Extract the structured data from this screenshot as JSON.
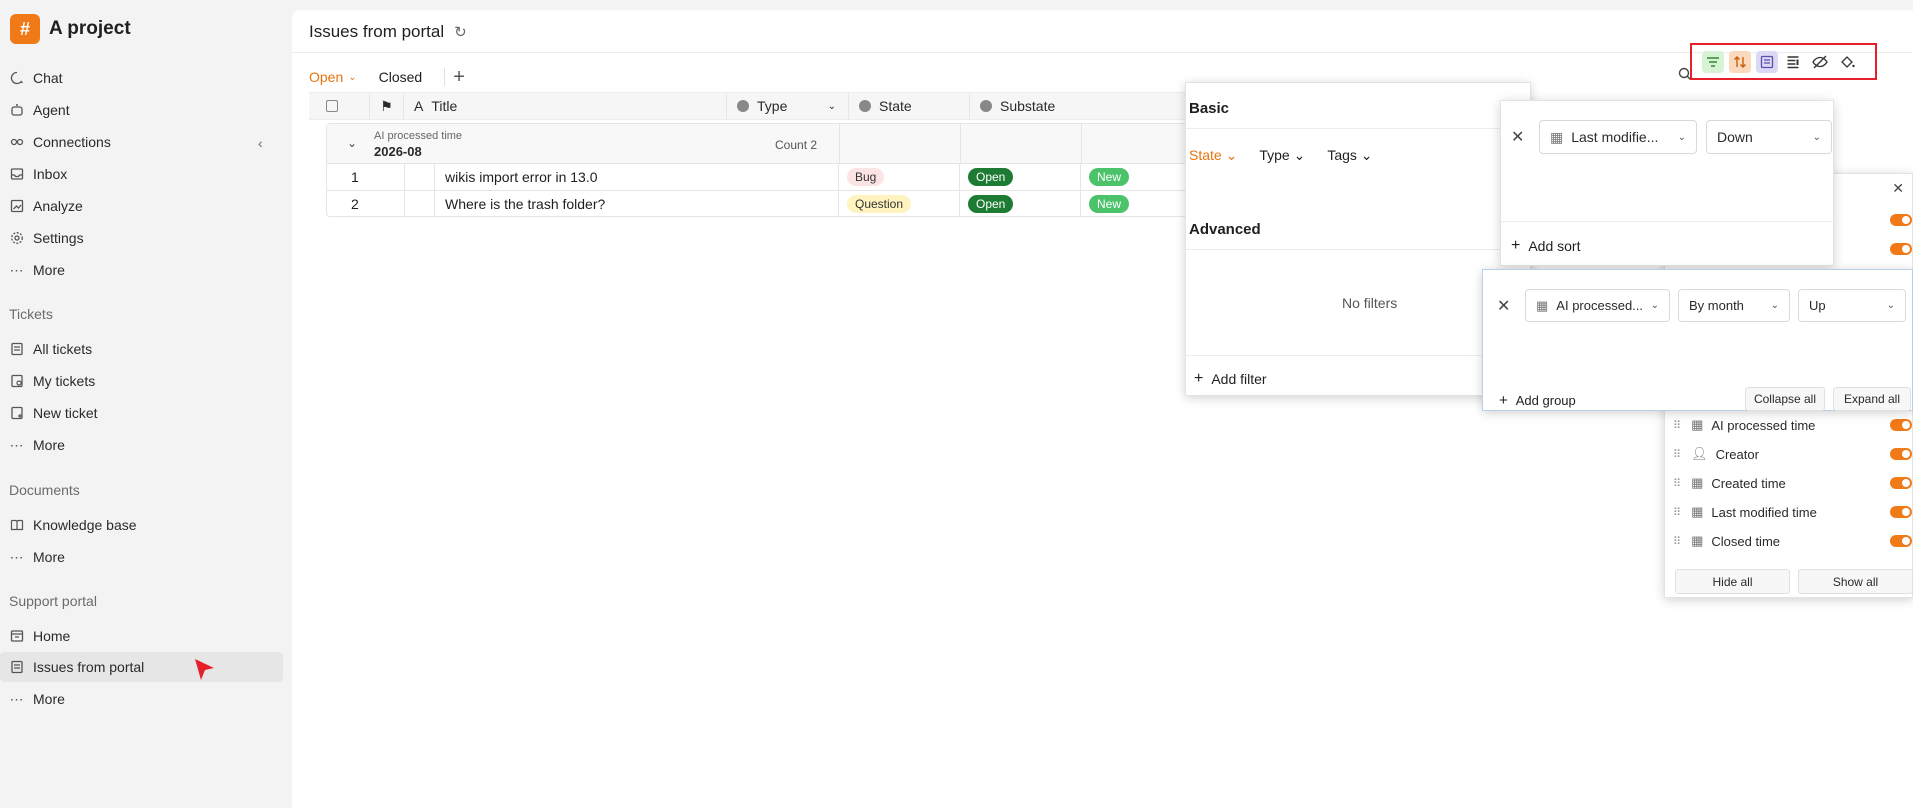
{
  "project": {
    "logo": "#",
    "name": "A project"
  },
  "nav": [
    {
      "label": "Chat",
      "icon": "chat-icon"
    },
    {
      "label": "Agent",
      "icon": "agent-icon"
    },
    {
      "label": "Connections",
      "icon": "connections-icon"
    },
    {
      "label": "Inbox",
      "icon": "inbox-icon"
    },
    {
      "label": "Analyze",
      "icon": "analyze-icon"
    },
    {
      "label": "Settings",
      "icon": "gear-icon"
    },
    {
      "label": "More",
      "icon": "more-icon"
    }
  ],
  "sections": {
    "tickets": {
      "title": "Tickets",
      "items": [
        "All tickets",
        "My tickets",
        "New ticket",
        "More"
      ]
    },
    "documents": {
      "title": "Documents",
      "items": [
        "Knowledge base",
        "More"
      ]
    },
    "portal": {
      "title": "Support portal",
      "items": [
        "Home",
        "Issues from portal",
        "More"
      ]
    }
  },
  "page": {
    "title": "Issues from portal"
  },
  "tabs": {
    "open": "Open",
    "closed": "Closed"
  },
  "columns": {
    "title": "Title",
    "type": "Type",
    "state": "State",
    "substate": "Substate"
  },
  "group": {
    "label": "AI processed time",
    "value": "2026-08",
    "count": "Count 2"
  },
  "rows": [
    {
      "num": "1",
      "title": "wikis import error in 13.0",
      "type": "Bug",
      "state": "Open",
      "substate": "New"
    },
    {
      "num": "2",
      "title": "Where is the trash folder?",
      "type": "Question",
      "state": "Open",
      "substate": "New"
    }
  ],
  "filter_panel": {
    "basic": "Basic",
    "chips": [
      "State",
      "Type",
      "Tags"
    ],
    "advanced": "Advanced",
    "empty": "No filters",
    "add": "Add filter"
  },
  "sort_panel": {
    "field": "Last modifie...",
    "direction": "Down",
    "add": "Add sort"
  },
  "group_panel": {
    "field": "AI processed...",
    "granularity": "By month",
    "direction": "Up",
    "add": "Add group",
    "collapse": "Collapse all",
    "expand": "Expand all"
  },
  "fields_panel": {
    "items": [
      "AI processed time",
      "Creator",
      "Created time",
      "Last modified time",
      "Closed time"
    ],
    "hide_all": "Hide all",
    "show_all": "Show all"
  },
  "colors": {
    "accent": "#f07918",
    "highlight_box": "#e5202b",
    "open_pill": "#1e7b34",
    "new_pill": "#4cc26b"
  }
}
